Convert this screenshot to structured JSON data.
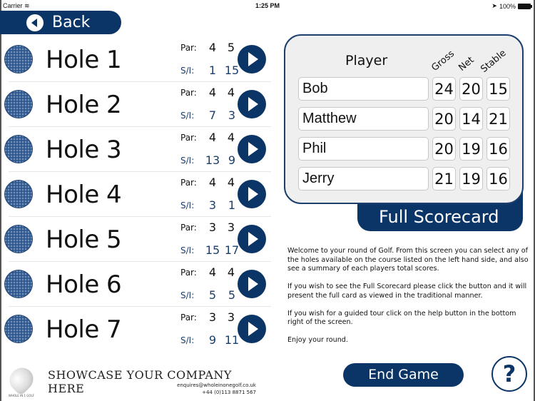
{
  "status_bar": {
    "carrier": "Carrier",
    "wifi_icon": "wifi-icon",
    "time": "1:25 PM",
    "location_icon": "➤",
    "battery": "100%"
  },
  "back_button": {
    "label": "Back",
    "icon": "back-arrow-icon"
  },
  "holes": [
    {
      "name": "Hole 1",
      "par_label": "Par:",
      "par": [
        "4",
        "5"
      ],
      "si_label": "S/I:",
      "si": [
        "1",
        "15"
      ]
    },
    {
      "name": "Hole 2",
      "par_label": "Par:",
      "par": [
        "4",
        "4"
      ],
      "si_label": "S/I:",
      "si": [
        "7",
        "3"
      ]
    },
    {
      "name": "Hole 3",
      "par_label": "Par:",
      "par": [
        "4",
        "4"
      ],
      "si_label": "S/I:",
      "si": [
        "13",
        "9"
      ]
    },
    {
      "name": "Hole 4",
      "par_label": "Par:",
      "par": [
        "4",
        "4"
      ],
      "si_label": "S/I:",
      "si": [
        "3",
        "1"
      ]
    },
    {
      "name": "Hole 5",
      "par_label": "Par:",
      "par": [
        "3",
        "3"
      ],
      "si_label": "S/I:",
      "si": [
        "15",
        "17"
      ]
    },
    {
      "name": "Hole 6",
      "par_label": "Par:",
      "par": [
        "4",
        "4"
      ],
      "si_label": "S/I:",
      "si": [
        "5",
        "5"
      ]
    },
    {
      "name": "Hole 7",
      "par_label": "Par:",
      "par": [
        "3",
        "3"
      ],
      "si_label": "S/I:",
      "si": [
        "9",
        "11"
      ]
    }
  ],
  "ad": {
    "headline": "SHOWCASE YOUR COMPANY HERE",
    "email": "enquires@wholeinonegolf.co.uk",
    "phone": "+44 (0)113 8871 567",
    "logo_text": "WHOLE IN 1 GOLF"
  },
  "scorecard": {
    "header_player": "Player",
    "header_gross": "Gross",
    "header_net": "Net",
    "header_stable": "Stable",
    "players": [
      {
        "name": "Bob",
        "gross": "24",
        "net": "20",
        "stable": "15"
      },
      {
        "name": "Matthew",
        "gross": "20",
        "net": "14",
        "stable": "21"
      },
      {
        "name": "Phil",
        "gross": "20",
        "net": "19",
        "stable": "16"
      },
      {
        "name": "Jerry",
        "gross": "21",
        "net": "19",
        "stable": "16"
      }
    ],
    "full_scorecard_label": "Full Scorecard"
  },
  "info": {
    "p1": "Welcome to your round of Golf. From this screen you can select any of the holes available on the course listed on the left hand side, and also see a summary of each players total scores.",
    "p2": "If you wish to see the Full Scorecard please click the button and it will present the full card as viewed in the traditional manner.",
    "p3": "If you wish for a guided tour click on the help button in the bottom right of the screen.",
    "p4": "Enjoy your round."
  },
  "end_game_label": "End Game",
  "help_label": "?",
  "colors": {
    "brand_navy": "#0b3566",
    "panel_bg": "#efefef",
    "si_blue": "#1c3e6a"
  }
}
